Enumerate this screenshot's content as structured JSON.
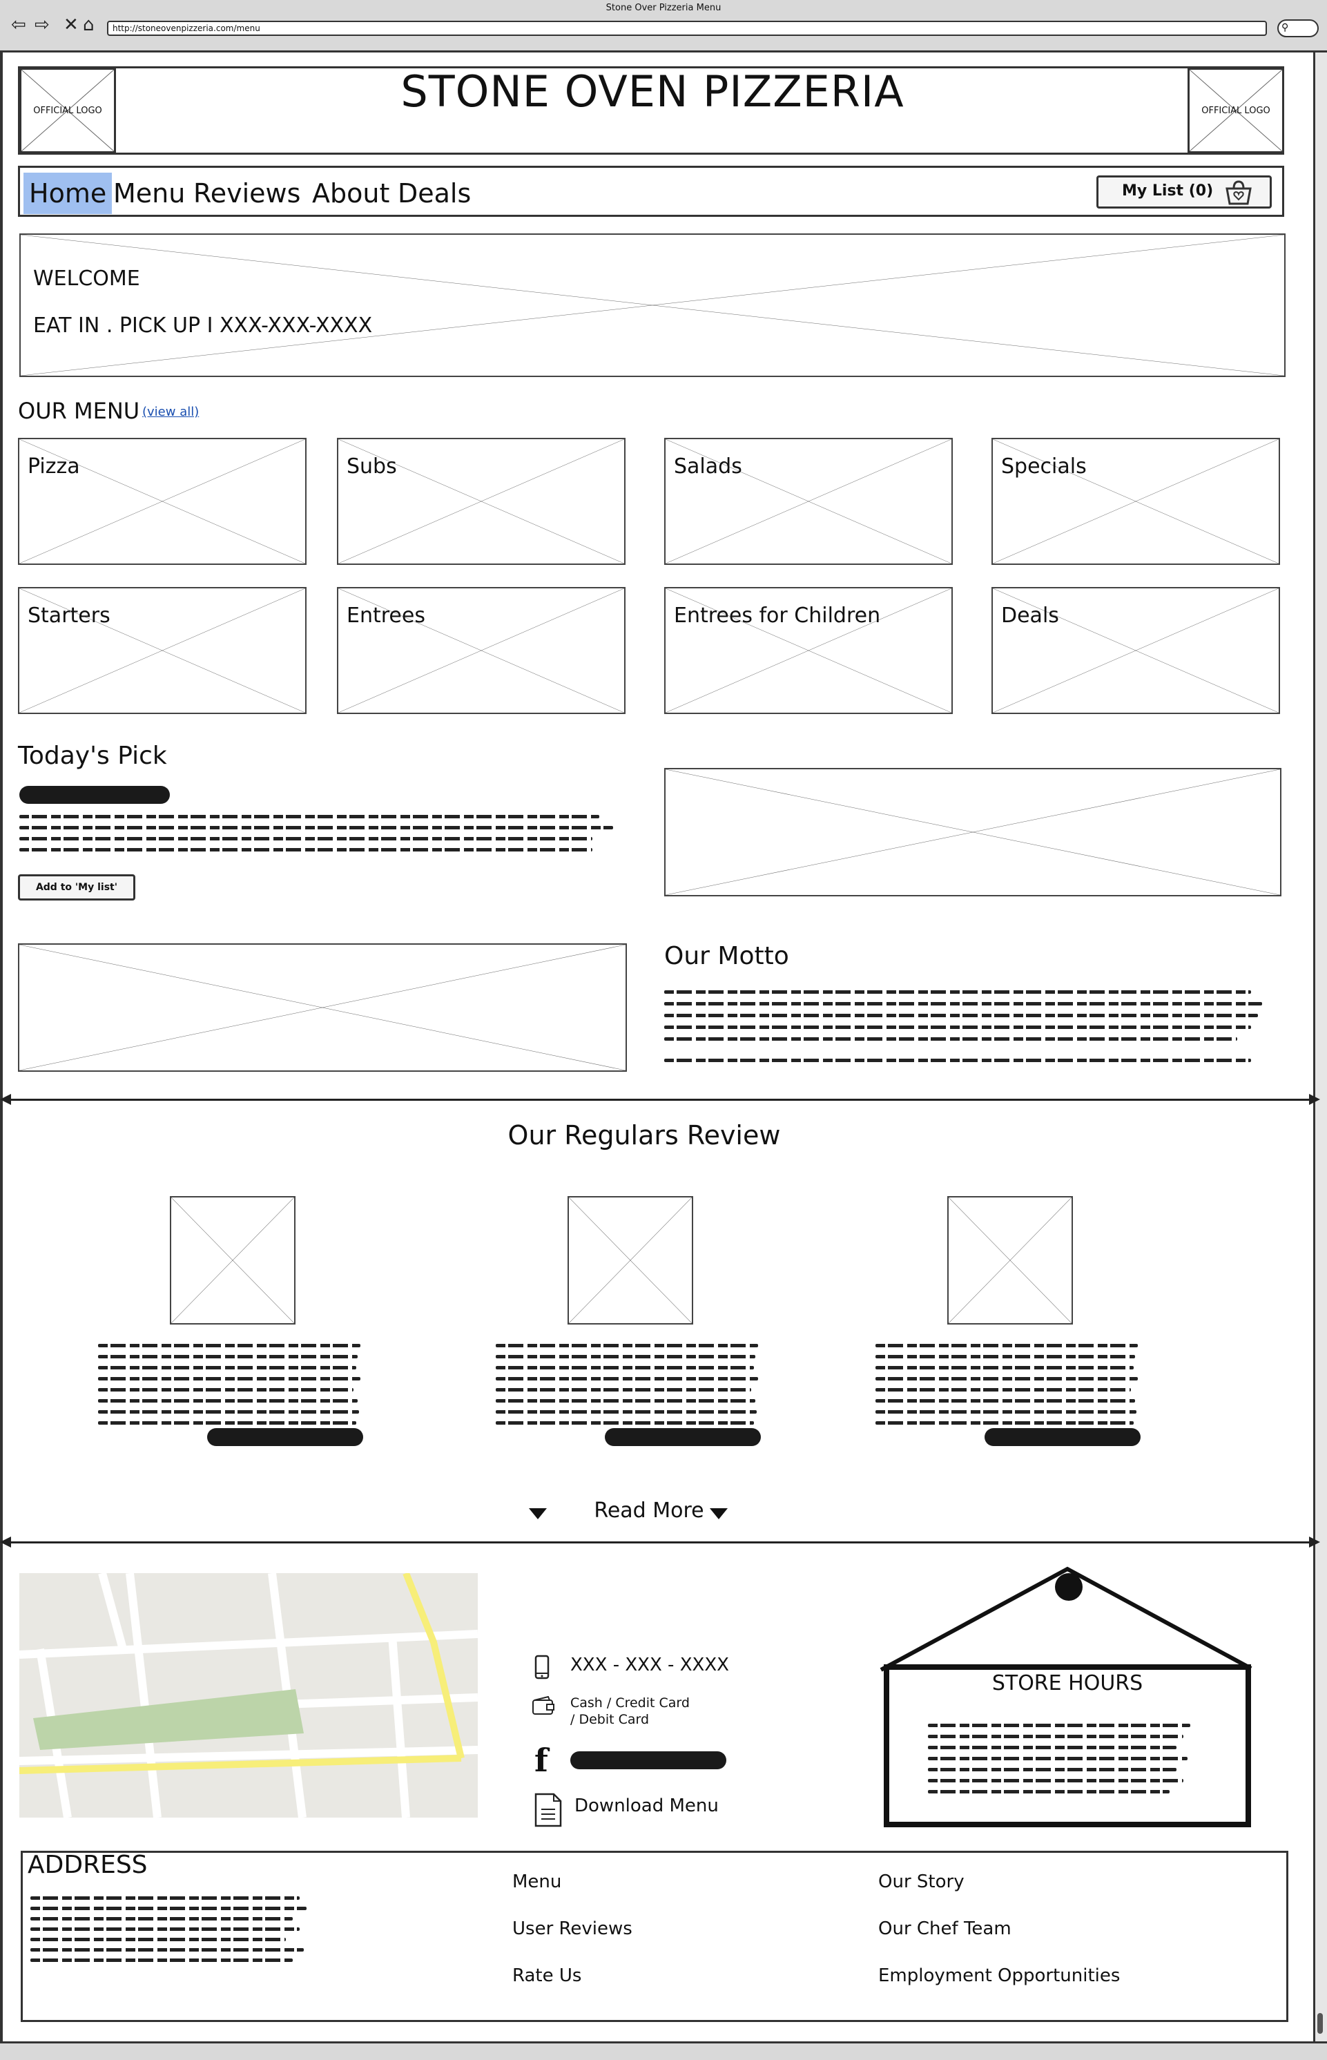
{
  "window": {
    "title": "Stone Over Pizzeria Menu",
    "url": "http://stoneovenpizzeria.com/menu"
  },
  "header": {
    "logo_left": "OFFICIAL LOGO",
    "logo_right": "OFFICIAL LOGO",
    "site_title": "STONE OVEN PIZZERIA"
  },
  "nav": {
    "items": [
      "Home",
      "Menu",
      "Reviews",
      "About",
      "Deals"
    ],
    "active": "Home",
    "my_list_label": "My List (0)"
  },
  "hero": {
    "line1": "WELCOME",
    "line2": "EAT IN . PICK UP I XXX-XXX-XXXX"
  },
  "our_menu": {
    "title": "OUR MENU",
    "view_all": "(view all)",
    "categories": [
      "Pizza",
      "Subs",
      "Salads",
      "Specials",
      "Starters",
      "Entrees",
      "Entrees for Children",
      "Deals"
    ]
  },
  "todays_pick": {
    "title": "Today's Pick",
    "add_button": "Add to 'My list'"
  },
  "motto": {
    "title": "Our Motto"
  },
  "reviews": {
    "title": "Our Regulars Review",
    "read_more": "Read More"
  },
  "contact": {
    "phone": "XXX - XXX - XXXX",
    "payment_line1": "Cash / Credit Card",
    "payment_line2": "/ Debit Card",
    "download": "Download Menu",
    "store_hours": "STORE HOURS"
  },
  "footer": {
    "address_title": "ADDRESS",
    "col1": [
      "Menu",
      "User Reviews",
      "Rate Us"
    ],
    "col2": [
      "Our Story",
      "Our Chef Team",
      "Employment Opportunities"
    ]
  },
  "icons": [
    "back-icon",
    "forward-icon",
    "stop-icon",
    "home-icon",
    "search-icon",
    "shopping-bag-icon",
    "phone-icon",
    "wallet-icon",
    "facebook-icon",
    "document-icon",
    "chevron-down-icon"
  ]
}
